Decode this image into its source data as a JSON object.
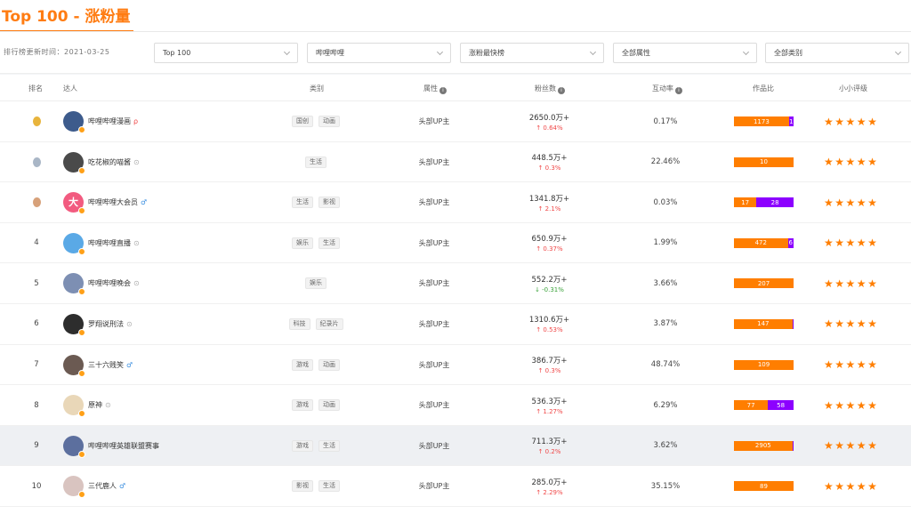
{
  "header": {
    "title": "Top 100 - 涨粉量"
  },
  "filters": {
    "update_time": "排行榜更新时间：2021-03-25",
    "selects": [
      {
        "value": "Top 100"
      },
      {
        "value": "哔哩哔哩"
      },
      {
        "value": "涨粉最快榜"
      },
      {
        "value": "全部属性"
      },
      {
        "value": "全部类别"
      }
    ]
  },
  "table": {
    "headers": {
      "rank": "排名",
      "creator": "达人",
      "category": "类别",
      "attribute": "属性",
      "fans": "粉丝数",
      "interaction": "互动率",
      "works": "作品比",
      "rating": "小小评级"
    },
    "info_icon": "i",
    "rows": [
      {
        "rank": "1",
        "medal": "gold",
        "name": "哔哩哔哩漫画",
        "name_icon": "ρ",
        "name_icon_color": "#f04848",
        "avatar_color": "#3d5b8c",
        "tags": [
          "国创",
          "动画"
        ],
        "attr": "头部UP主",
        "fans": "2650.0万+",
        "change": "↑ 0.64%",
        "dir": "up",
        "bar": [
          {
            "label": "1173",
            "value": 1173,
            "c": "o"
          },
          {
            "label": "1",
            "value": 100,
            "c": "p"
          }
        ],
        "stars": 5,
        "hl": false
      },
      {
        "rank": "2",
        "medal": "silver",
        "name": "吃花椒的喵酱",
        "name_icon": "⊙",
        "name_icon_color": "#aaa",
        "avatar_color": "#4a4a4a",
        "tags": [
          "生活"
        ],
        "attr": "头部UP主",
        "fans": "448.5万+",
        "change": "↑ 0.3%",
        "dir": "up",
        "bar": [
          {
            "label": "10",
            "value": 10,
            "c": "o"
          }
        ],
        "stars": 5,
        "hl": false
      },
      {
        "rank": "3",
        "medal": "bronze",
        "name": "哔哩哔哩大会员",
        "name_icon": "♂",
        "name_icon_color": "#3b8fe0",
        "avatar_color": "#f25b80",
        "avatar_text": "大",
        "tags": [
          "生活",
          "影视"
        ],
        "attr": "头部UP主",
        "fans": "1341.8万+",
        "change": "↑ 2.1%",
        "dir": "up",
        "bar": [
          {
            "label": "17",
            "value": 17,
            "c": "o"
          },
          {
            "label": "28",
            "value": 28,
            "c": "p"
          }
        ],
        "stars": 5,
        "hl": false
      },
      {
        "rank": "4",
        "medal": "",
        "name": "哔哩哔哩直播",
        "name_icon": "⊙",
        "name_icon_color": "#aaa",
        "avatar_color": "#5aa9e6",
        "tags": [
          "娱乐",
          "生活"
        ],
        "attr": "头部UP主",
        "fans": "650.9万+",
        "change": "↑ 0.37%",
        "dir": "up",
        "bar": [
          {
            "label": "472",
            "value": 472,
            "c": "o"
          },
          {
            "label": "6",
            "value": 50,
            "c": "p"
          }
        ],
        "stars": 5,
        "hl": false
      },
      {
        "rank": "5",
        "medal": "",
        "name": "哔哩哔哩晚会",
        "name_icon": "⊙",
        "name_icon_color": "#aaa",
        "avatar_color": "#7d8fb3",
        "tags": [
          "娱乐"
        ],
        "attr": "头部UP主",
        "fans": "552.2万+",
        "change": "↓ -0.31%",
        "dir": "down",
        "bar": [
          {
            "label": "207",
            "value": 207,
            "c": "o"
          }
        ],
        "stars": 5,
        "hl": false
      },
      {
        "rank": "6",
        "medal": "",
        "name": "罗翔说刑法",
        "name_icon": "⊙",
        "name_icon_color": "#aaa",
        "avatar_color": "#2d2d2d",
        "tags": [
          "科技",
          "纪录片"
        ],
        "attr": "头部UP主",
        "fans": "1310.6万+",
        "change": "↑ 0.53%",
        "dir": "up",
        "bar": [
          {
            "label": "147",
            "value": 147,
            "c": "o"
          },
          {
            "label": "",
            "value": 3,
            "c": "p"
          }
        ],
        "stars": 5,
        "hl": false
      },
      {
        "rank": "7",
        "medal": "",
        "name": "三十六贱笑",
        "name_icon": "♂",
        "name_icon_color": "#3b8fe0",
        "avatar_color": "#6b5a52",
        "tags": [
          "游戏",
          "动画"
        ],
        "attr": "头部UP主",
        "fans": "386.7万+",
        "change": "↑ 0.3%",
        "dir": "up",
        "bar": [
          {
            "label": "109",
            "value": 109,
            "c": "o"
          }
        ],
        "stars": 5,
        "hl": false
      },
      {
        "rank": "8",
        "medal": "",
        "name": "原神",
        "name_icon": "⊙",
        "name_icon_color": "#aaa",
        "avatar_color": "#e9d7b8",
        "tags": [
          "游戏",
          "动画"
        ],
        "attr": "头部UP主",
        "fans": "536.3万+",
        "change": "↑ 1.27%",
        "dir": "up",
        "bar": [
          {
            "label": "77",
            "value": 77,
            "c": "o"
          },
          {
            "label": "58",
            "value": 58,
            "c": "p"
          }
        ],
        "stars": 5,
        "hl": false
      },
      {
        "rank": "9",
        "medal": "",
        "name": "哔哩哔哩英雄联盟赛事",
        "name_icon": "",
        "name_icon_color": "#aaa",
        "avatar_color": "#5c6f9e",
        "tags": [
          "游戏",
          "生活"
        ],
        "attr": "头部UP主",
        "fans": "711.3万+",
        "change": "↑ 0.2%",
        "dir": "up",
        "bar": [
          {
            "label": "2905",
            "value": 2905,
            "c": "o"
          },
          {
            "label": "",
            "value": 60,
            "c": "p"
          }
        ],
        "stars": 5,
        "hl": true
      },
      {
        "rank": "10",
        "medal": "",
        "name": "三代鹿人",
        "name_icon": "♂",
        "name_icon_color": "#3b8fe0",
        "avatar_color": "#d9c4c0",
        "tags": [
          "影视",
          "生活"
        ],
        "attr": "头部UP主",
        "fans": "285.0万+",
        "change": "↑ 2.29%",
        "dir": "up",
        "bar": [
          {
            "label": "89",
            "value": 89,
            "c": "o"
          }
        ],
        "stars": 5,
        "hl": false
      }
    ]
  },
  "colors": {
    "accent": "#ff7c12",
    "bar_orange": "#ff7e00",
    "bar_purple": "#8c00ff",
    "up": "#f04848",
    "down": "#3ca33c"
  },
  "icons": {
    "star": "★",
    "chevron": "chevron-down-icon",
    "medal": "medal-icon",
    "verified": "verified-icon"
  }
}
